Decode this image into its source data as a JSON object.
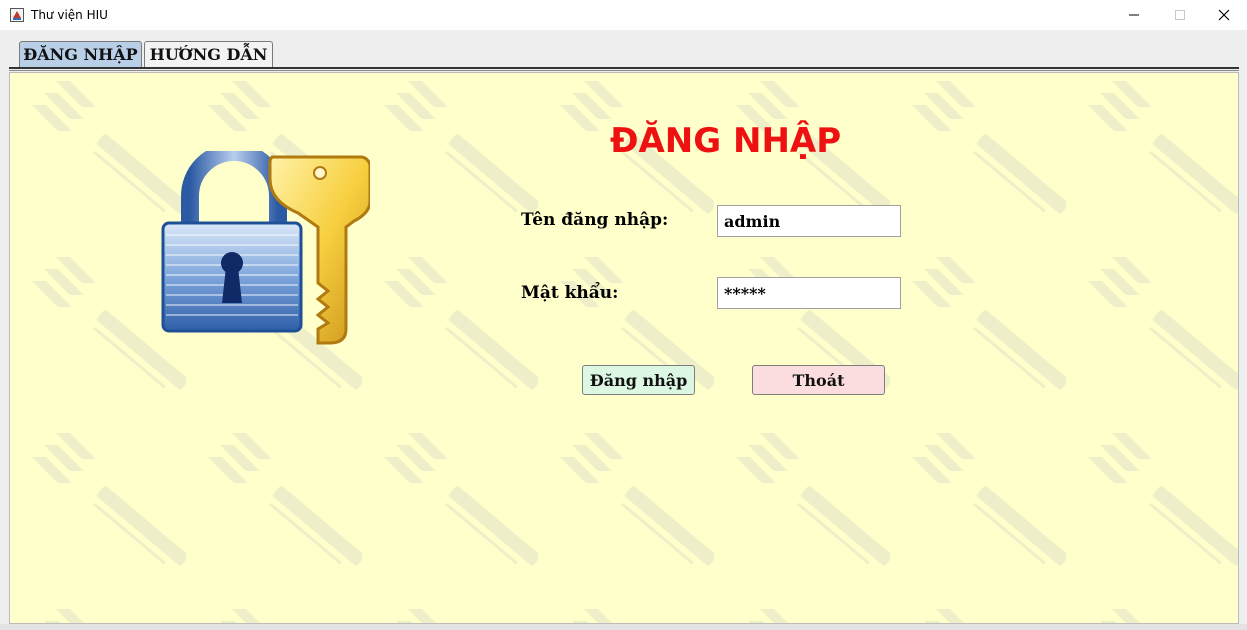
{
  "window": {
    "title": "Thư viện HIU",
    "controls": {
      "minimize": "─",
      "maximize": "☐",
      "close": "✕"
    }
  },
  "tabs": [
    {
      "label": "ĐĂNG NHẬP",
      "active": true
    },
    {
      "label": "HƯỚNG DẪN",
      "active": false
    }
  ],
  "login": {
    "heading": "ĐĂNG NHẬP",
    "username_label": "Tên đăng nhập:",
    "username_value": "admin",
    "password_label": "Mật khẩu:",
    "password_value": "*****",
    "login_button": "Đăng nhập",
    "exit_button": "Thoát"
  },
  "illustration": {
    "icon": "padlock-with-key-icon"
  },
  "colors": {
    "content_background": "#ffffcc",
    "heading": "#ee1111",
    "active_tab": "#b9cfe7",
    "login_button": "#dcf7e2",
    "exit_button": "#fbdde0"
  }
}
